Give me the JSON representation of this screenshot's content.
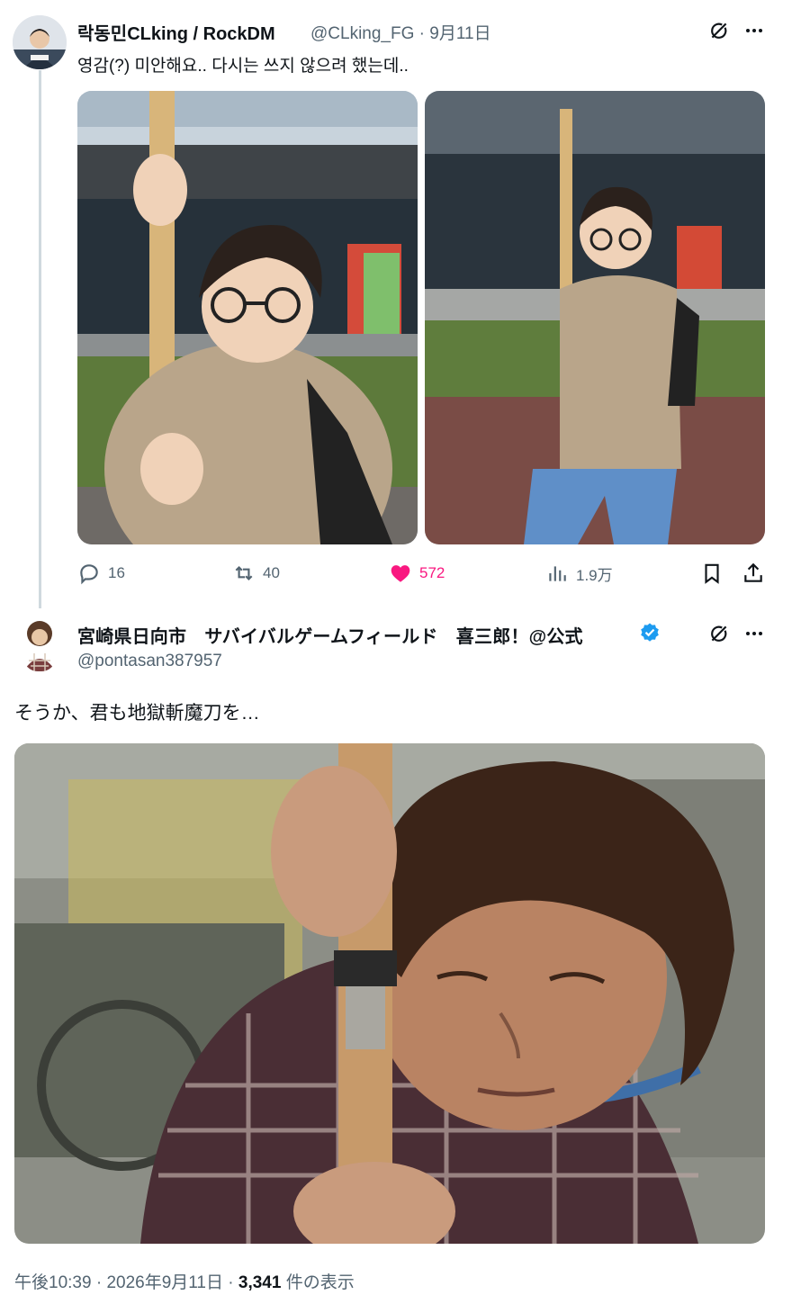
{
  "tweet1": {
    "author_name": "락동민CLking / RockDM",
    "handle": "@CLking_FG",
    "date": "9月11日",
    "text": "영감(?) 미안해요.. 다시는 쓰지 않으려 했는데..",
    "stats": {
      "replies": "16",
      "retweets": "40",
      "likes": "572",
      "views": "1.9万"
    },
    "icons": [
      "grok-icon",
      "more-icon",
      "reply-icon",
      "retweet-icon",
      "heart-icon",
      "views-icon",
      "bookmark-icon",
      "share-icon"
    ]
  },
  "tweet2": {
    "author_name": "宮崎県日向市　サバイバルゲームフィールド　喜三郎！@公式",
    "handle": "@pontasan387957",
    "text": "そうか、君も地獄斬魔刀を…",
    "footer_time": "午後10:39",
    "footer_date": "2026年9月11日",
    "footer_views": "3,341",
    "footer_views_label": "件の表示",
    "separator": "·"
  },
  "colors": {
    "text": "#0f1419",
    "secondary": "#536471",
    "like": "#f91880",
    "verified": "#1d9bf0",
    "thread_line": "#cfd9de"
  }
}
